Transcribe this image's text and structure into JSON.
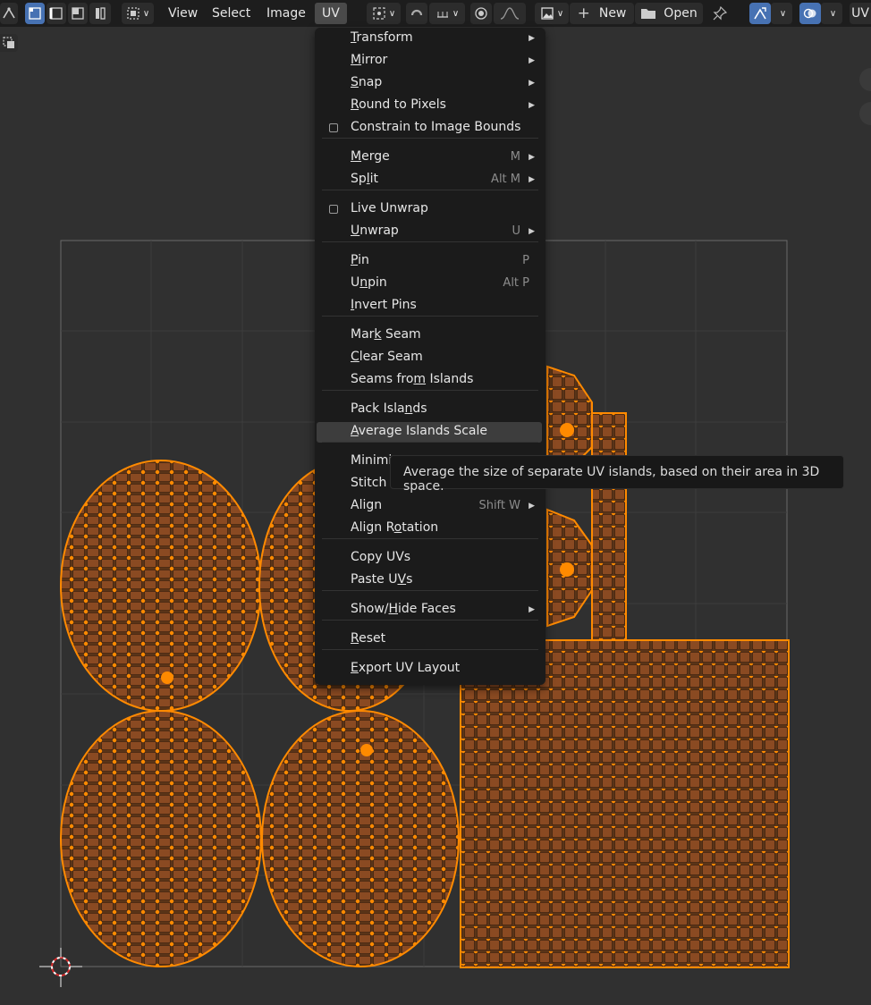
{
  "header": {
    "menus": {
      "view": "View",
      "select": "Select",
      "image": "Image",
      "uv": "UV"
    },
    "new_label": "New",
    "open_label": "Open",
    "editor_label": "UV"
  },
  "uv_menu": {
    "items": [
      {
        "label": "Transform",
        "submenu": true
      },
      {
        "label": "Mirror",
        "submenu": true
      },
      {
        "label": "Snap",
        "submenu": true
      },
      {
        "label": "Round to Pixels",
        "submenu": true
      },
      {
        "label": "Constrain to Image Bounds",
        "checkbox": true
      },
      {
        "label": "Merge",
        "shortcut": "M",
        "submenu": true
      },
      {
        "label": "Split",
        "shortcut": "Alt M",
        "submenu": true
      },
      {
        "label": "Live Unwrap",
        "checkbox": true
      },
      {
        "label": "Unwrap",
        "shortcut": "U",
        "submenu": true
      },
      {
        "label": "Pin",
        "shortcut": "P"
      },
      {
        "label": "Unpin",
        "shortcut": "Alt P"
      },
      {
        "label": "Invert Pins"
      },
      {
        "label": "Mark Seam"
      },
      {
        "label": "Clear Seam"
      },
      {
        "label": "Seams from Islands"
      },
      {
        "label": "Pack Islands"
      },
      {
        "label": "Average Islands Scale",
        "highlighted": true
      },
      {
        "label": "Minimi"
      },
      {
        "label": "Stitch"
      },
      {
        "label": "Align",
        "shortcut": "Shift W",
        "submenu": true
      },
      {
        "label": "Align Rotation"
      },
      {
        "label": "Copy UVs"
      },
      {
        "label": "Paste UVs"
      },
      {
        "label": "Show/Hide Faces",
        "submenu": true
      },
      {
        "label": "Reset"
      },
      {
        "label": "Export UV Layout"
      }
    ]
  },
  "tooltip": {
    "text": "Average the size of separate UV islands, based on their area in 3D space."
  },
  "colors": {
    "header_bg": "#1d1d1d",
    "viewport_bg": "#303030",
    "accent_blue": "#4772b3",
    "uv_face": "#8a4a22",
    "uv_vertex": "#ff8a00"
  }
}
